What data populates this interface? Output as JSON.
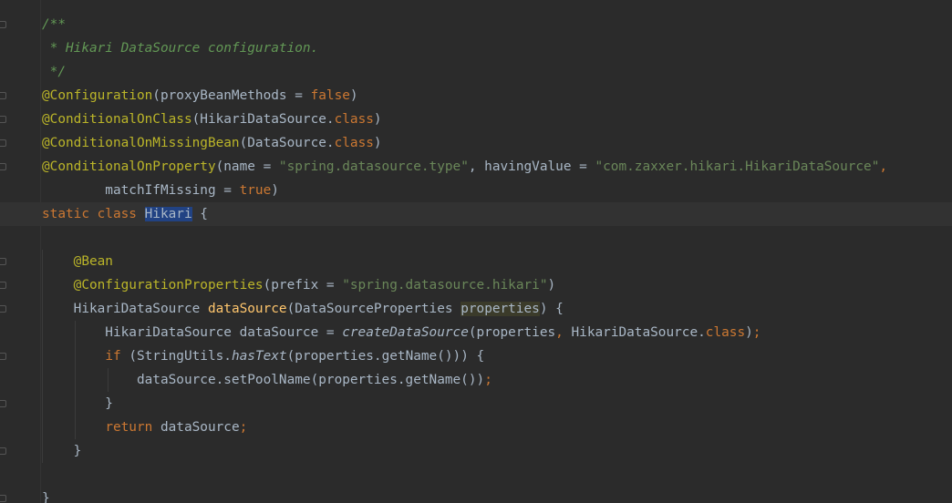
{
  "editor": {
    "language": "java",
    "theme_colors": {
      "background": "#2b2b2b",
      "keyword": "#cc7832",
      "annotation": "#bbb529",
      "string": "#6a8759",
      "comment": "#629755",
      "method": "#ffc66d",
      "text": "#a9b7c6",
      "selection": "#214283"
    },
    "gutter_icons": [
      "fold-marker-icon",
      "intention-bulb-icon"
    ],
    "lines": [
      [
        {
          "t": "/**",
          "c": "com"
        }
      ],
      [
        {
          "t": " * Hikari DataSource configuration.",
          "c": "com"
        }
      ],
      [
        {
          "t": " */",
          "c": "com"
        }
      ],
      [
        {
          "t": "@Configuration",
          "c": "ann"
        },
        {
          "t": "(proxyBeanMethods = ",
          "c": "txt"
        },
        {
          "t": "false",
          "c": "kw"
        },
        {
          "t": ")",
          "c": "txt"
        }
      ],
      [
        {
          "t": "@ConditionalOnClass",
          "c": "ann"
        },
        {
          "t": "(HikariDataSource.",
          "c": "txt"
        },
        {
          "t": "class",
          "c": "kw"
        },
        {
          "t": ")",
          "c": "txt"
        }
      ],
      [
        {
          "t": "@ConditionalOnMissingBean",
          "c": "ann"
        },
        {
          "t": "(DataSource.",
          "c": "txt"
        },
        {
          "t": "class",
          "c": "kw"
        },
        {
          "t": ")",
          "c": "txt"
        }
      ],
      [
        {
          "t": "@ConditionalOnProperty",
          "c": "ann"
        },
        {
          "t": "(name = ",
          "c": "txt"
        },
        {
          "t": "\"spring.datasource.type\"",
          "c": "str"
        },
        {
          "t": ", havingValue = ",
          "c": "txt"
        },
        {
          "t": "\"com.zaxxer.hikari.HikariDataSource\"",
          "c": "str"
        },
        {
          "t": ",",
          "c": "kw"
        }
      ],
      [
        {
          "t": "        matchIfMissing = ",
          "c": "txt"
        },
        {
          "t": "true",
          "c": "kw"
        },
        {
          "t": ")",
          "c": "txt"
        }
      ],
      [
        {
          "t": "static class ",
          "c": "kw"
        },
        {
          "t": "Hikari",
          "c": "sel"
        },
        {
          "t": " {",
          "c": "txt"
        }
      ],
      [],
      [
        {
          "t": "    ",
          "c": "txt"
        },
        {
          "t": "@Bean",
          "c": "ann"
        }
      ],
      [
        {
          "t": "    ",
          "c": "txt"
        },
        {
          "t": "@ConfigurationProperties",
          "c": "ann"
        },
        {
          "t": "(prefix = ",
          "c": "txt"
        },
        {
          "t": "\"spring.datasource.hikari\"",
          "c": "str"
        },
        {
          "t": ")",
          "c": "txt"
        }
      ],
      [
        {
          "t": "    HikariDataSource ",
          "c": "txt"
        },
        {
          "t": "dataSource",
          "c": "fn"
        },
        {
          "t": "(DataSourceProperties ",
          "c": "txt"
        },
        {
          "t": "properties",
          "c": "param"
        },
        {
          "t": ") {",
          "c": "txt"
        }
      ],
      [
        {
          "t": "        HikariDataSource dataSource = ",
          "c": "txt"
        },
        {
          "t": "createDataSource",
          "c": "it"
        },
        {
          "t": "(properties",
          "c": "txt"
        },
        {
          "t": ", ",
          "c": "kw"
        },
        {
          "t": "HikariDataSource.",
          "c": "txt"
        },
        {
          "t": "class",
          "c": "kw"
        },
        {
          "t": ")",
          "c": "txt"
        },
        {
          "t": ";",
          "c": "kw"
        }
      ],
      [
        {
          "t": "        ",
          "c": "txt"
        },
        {
          "t": "if ",
          "c": "kw"
        },
        {
          "t": "(StringUtils.",
          "c": "txt"
        },
        {
          "t": "hasText",
          "c": "it"
        },
        {
          "t": "(properties.getName())) {",
          "c": "txt"
        }
      ],
      [
        {
          "t": "            dataSource.setPoolName(properties.getName())",
          "c": "txt"
        },
        {
          "t": ";",
          "c": "kw"
        }
      ],
      [
        {
          "t": "        }",
          "c": "txt"
        }
      ],
      [
        {
          "t": "        ",
          "c": "txt"
        },
        {
          "t": "return ",
          "c": "kw"
        },
        {
          "t": "dataSource",
          "c": "txt"
        },
        {
          "t": ";",
          "c": "kw"
        }
      ],
      [
        {
          "t": "    }",
          "c": "txt"
        }
      ],
      [],
      [
        {
          "t": "}",
          "c": "txt"
        }
      ]
    ]
  }
}
